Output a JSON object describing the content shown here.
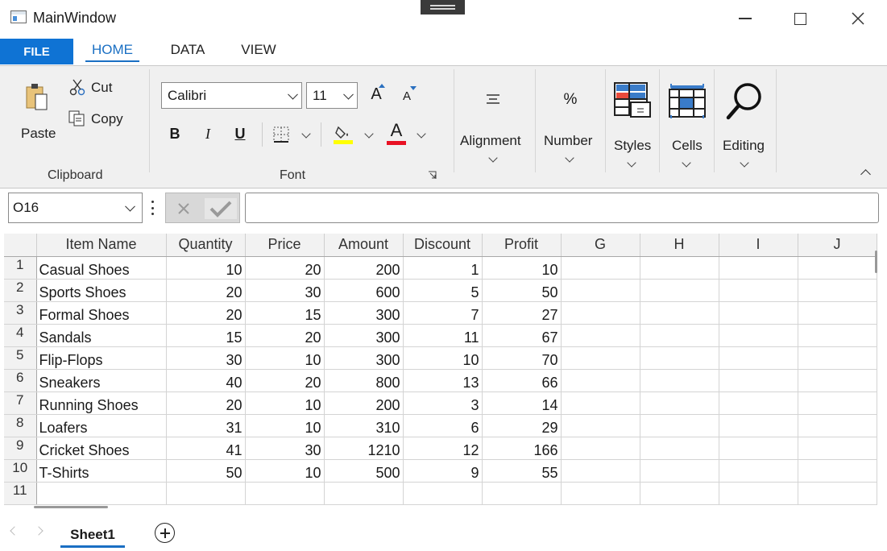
{
  "window": {
    "title": "MainWindow"
  },
  "ribbon_tabs": [
    "FILE",
    "HOME",
    "DATA",
    "VIEW"
  ],
  "clipboard": {
    "paste": "Paste",
    "cut": "Cut",
    "copy": "Copy",
    "group": "Clipboard"
  },
  "font": {
    "family": "Calibri",
    "size": "11",
    "bold": "B",
    "italic": "I",
    "underline": "U",
    "group": "Font",
    "grow": "A",
    "shrink": "A",
    "color": "A"
  },
  "groups": {
    "alignment": "Alignment",
    "number": "Number",
    "styles": "Styles",
    "cells": "Cells",
    "editing": "Editing",
    "number_symbol": "%"
  },
  "formula_bar": {
    "cell_ref": "O16",
    "formula": ""
  },
  "columns": [
    "Item Name",
    "Quantity",
    "Price",
    "Amount",
    "Discount",
    "Profit",
    "G",
    "H",
    "I",
    "J"
  ],
  "rows": [
    {
      "num": "1",
      "cells": [
        "Casual Shoes",
        "10",
        "20",
        "200",
        "1",
        "10"
      ]
    },
    {
      "num": "2",
      "cells": [
        "Sports Shoes",
        "20",
        "30",
        "600",
        "5",
        "50"
      ]
    },
    {
      "num": "3",
      "cells": [
        "Formal Shoes",
        "20",
        "15",
        "300",
        "7",
        "27"
      ]
    },
    {
      "num": "4",
      "cells": [
        "Sandals",
        "15",
        "20",
        "300",
        "11",
        "67"
      ]
    },
    {
      "num": "5",
      "cells": [
        "Flip-Flops",
        "30",
        "10",
        "300",
        "10",
        "70"
      ]
    },
    {
      "num": "6",
      "cells": [
        "Sneakers",
        "40",
        "20",
        "800",
        "13",
        "66"
      ]
    },
    {
      "num": "7",
      "cells": [
        "Running Shoes",
        "20",
        "10",
        "200",
        "3",
        "14"
      ]
    },
    {
      "num": "8",
      "cells": [
        "Loafers",
        "31",
        "10",
        "310",
        "6",
        "29"
      ]
    },
    {
      "num": "9",
      "cells": [
        "Cricket Shoes",
        "41",
        "30",
        "1210",
        "12",
        "166"
      ]
    },
    {
      "num": "10",
      "cells": [
        "T-Shirts",
        "50",
        "10",
        "500",
        "9",
        "55"
      ]
    },
    {
      "num": "11",
      "cells": [
        "",
        "",
        "",
        "",
        "",
        ""
      ]
    }
  ],
  "sheets": {
    "active": "Sheet1"
  },
  "colors": {
    "accent": "#0f73d4",
    "highlight": "#ffff00",
    "font_color": "#e81123"
  }
}
